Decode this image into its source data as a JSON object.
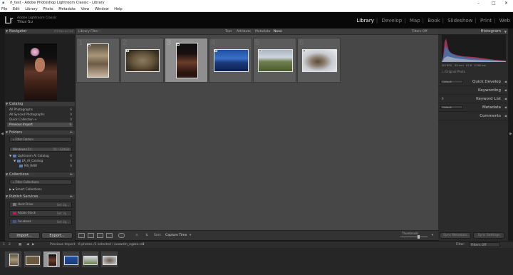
{
  "window": {
    "title": "rl_test - Adobe Photoshop Lightroom Classic - Library",
    "controls": [
      "–",
      "□",
      "✕"
    ]
  },
  "menu": [
    "File",
    "Edit",
    "Library",
    "Photo",
    "Metadata",
    "View",
    "Window",
    "Help"
  ],
  "identity": {
    "logo": "Lr",
    "app_name": "Adobe Lightroom Classic",
    "user": "Titus Su"
  },
  "modules": {
    "items": [
      "Library",
      "Develop",
      "Map",
      "Book",
      "Slideshow",
      "Print",
      "Web"
    ],
    "active": "Library"
  },
  "left_panel": {
    "navigator": {
      "title": "Navigator",
      "zoom": [
        "FIT",
        "FILL",
        "1:1",
        "3:1"
      ]
    },
    "catalog": {
      "title": "Catalog",
      "items": [
        {
          "label": "All Photographs",
          "count": "6"
        },
        {
          "label": "All Synced Photographs",
          "count": "0"
        },
        {
          "label": "Quick Collection +",
          "count": "0"
        },
        {
          "label": "Previous Import",
          "count": "6"
        }
      ]
    },
    "folders": {
      "title": "Folders",
      "filter_placeholder": "Filter Folders",
      "volume": "Windows (C:)",
      "volume_info": "55 / 120GB",
      "tree": [
        {
          "label": "Lightroom AI Catalog",
          "count": "6"
        },
        {
          "label": "LR_AI_Catalog",
          "count": "6"
        },
        {
          "label": "MS_RAW",
          "count": "6"
        }
      ]
    },
    "collections": {
      "title": "Collections",
      "filter_placeholder": "Filter Collections",
      "items": [
        {
          "label": "Smart Collections"
        }
      ]
    },
    "publish": {
      "title": "Publish Services",
      "items": [
        {
          "label": "Hard Drive",
          "action": "Set Up..."
        },
        {
          "label": "Adobe Stock",
          "action": "Set Up..."
        },
        {
          "label": "Facebook",
          "action": "Set Up..."
        }
      ]
    },
    "import_label": "Import...",
    "export_label": "Export..."
  },
  "library_filter": {
    "label": "Library Filter :",
    "options": [
      "Text",
      "Attribute",
      "Metadata",
      "None"
    ],
    "selected": "None",
    "preset": "Filters Off"
  },
  "grid": {
    "cells": [
      {
        "index": "1",
        "subject": "woman-with-laptop"
      },
      {
        "index": "2",
        "subject": "cat"
      },
      {
        "index": "3",
        "subject": "portrait-woman",
        "selected": true
      },
      {
        "index": "4",
        "subject": "blue-landscape"
      },
      {
        "index": "5",
        "subject": "mountain-field"
      },
      {
        "index": "6",
        "subject": "dog-in-snow"
      }
    ]
  },
  "toolbar": {
    "sort_label": "Sort:",
    "sort_value": "Capture Time",
    "thumbnails_label": "Thumbnails"
  },
  "right_panel": {
    "histogram": {
      "title": "Histogram",
      "info": [
        "ISO 800",
        "85 mm",
        "f/1.8",
        "1/160 sec"
      ],
      "original_photo": "Original Photo"
    },
    "panels": [
      "Quick Develop",
      "Keywording",
      "Keyword List",
      "Metadata",
      "Comments"
    ],
    "quick_develop_preset": "Default",
    "metadata_preset": "Default",
    "keyword_count": "0",
    "sync_metadata": "Sync Metadata",
    "sync_settings": "Sync Settings"
  },
  "filmstrip": {
    "pages": [
      "1",
      "2"
    ],
    "source": "Previous Import",
    "status": "6 photos /1 selected /",
    "filename": "/uwwdm_ngzzz.cr2",
    "filter_label": "Filter:",
    "filter_value": "Filters Off"
  }
}
